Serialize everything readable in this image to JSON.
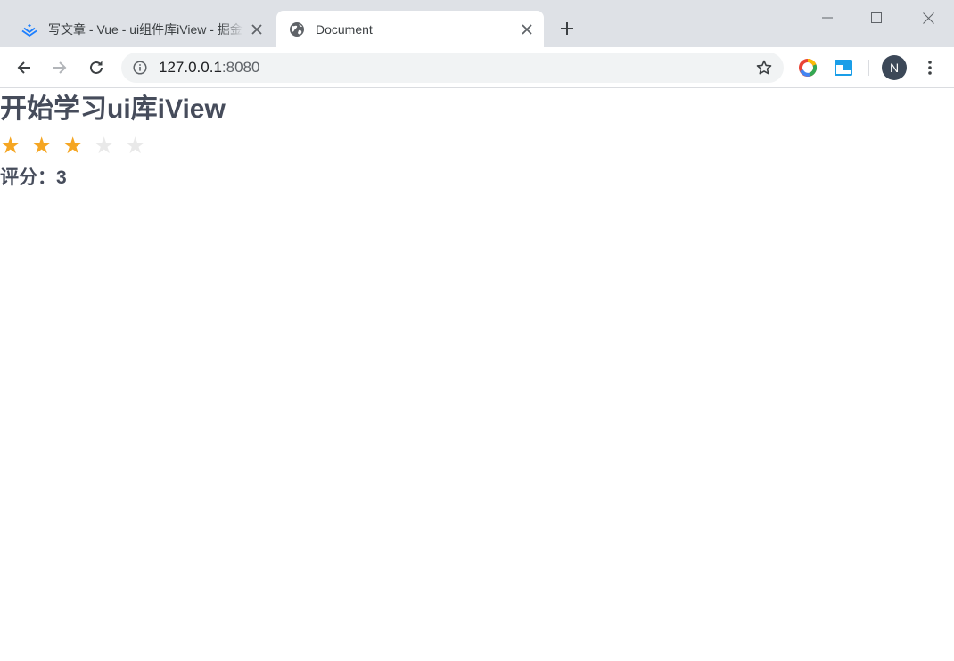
{
  "browser": {
    "tabs": [
      {
        "title": "写文章 - Vue - ui组件库iView - 掘金",
        "icon": "juejin-logo-icon",
        "active": false
      },
      {
        "title": "Document",
        "icon": "globe-icon",
        "active": true
      }
    ],
    "address": {
      "host": "127.0.0.1",
      "port": ":8080"
    },
    "profile_initial": "N",
    "icons": {
      "back": "arrow-left-icon",
      "forward": "arrow-right-icon",
      "reload": "reload-icon",
      "site_info": "info-icon",
      "bookmark": "star-outline-icon",
      "extension_1": "ring-extension-icon",
      "extension_2": "cast-extension-icon",
      "menu": "more-vertical-icon"
    }
  },
  "page": {
    "heading": "开始学习ui库iView",
    "rating": {
      "value": 3,
      "max": 5,
      "star_glyph": "★"
    },
    "score_text": "评分：3"
  },
  "colors": {
    "star_active": "#f5a623",
    "star_inactive": "#e9e9e9",
    "text": "#464c5b",
    "tabstrip": "#dee1e6",
    "juejin_blue": "#1e80ff"
  }
}
